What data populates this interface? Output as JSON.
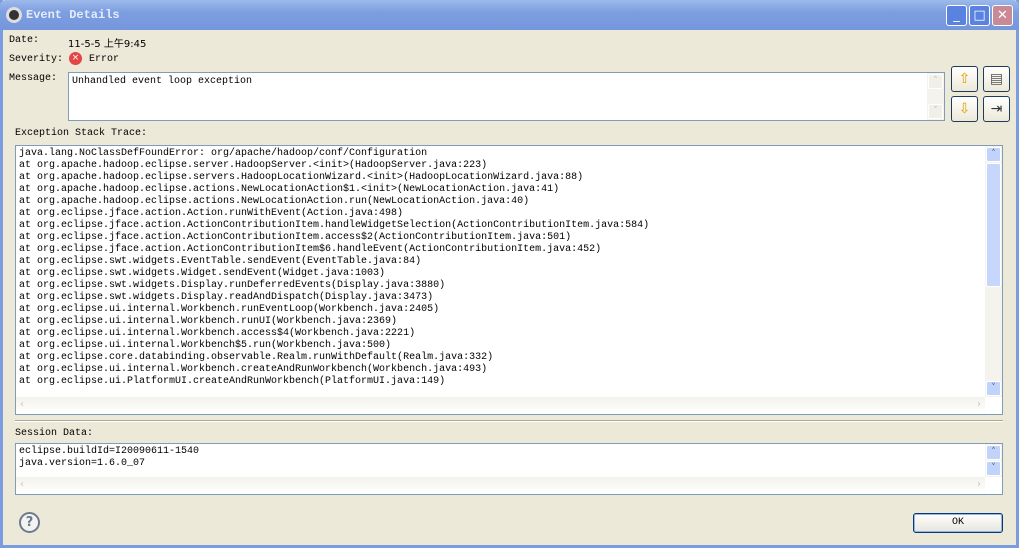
{
  "window": {
    "title": "Event Details",
    "minimize": "_",
    "maximize": "□",
    "close": "✕"
  },
  "date": {
    "label": "Date:",
    "value": "11-5-5 上午9:45"
  },
  "severity": {
    "label": "Severity:",
    "value": "Error",
    "icon": "error-icon"
  },
  "message": {
    "label": "Message:",
    "value": "Unhandled event loop exception"
  },
  "side_buttons": {
    "previous": "⇧",
    "next": "⇩",
    "copy": "▤",
    "filter": "⇥"
  },
  "stack": {
    "label": "Exception Stack Trace:",
    "lines": [
      "java.lang.NoClassDefFoundError: org/apache/hadoop/conf/Configuration",
      "at org.apache.hadoop.eclipse.server.HadoopServer.<init>(HadoopServer.java:223)",
      "at org.apache.hadoop.eclipse.servers.HadoopLocationWizard.<init>(HadoopLocationWizard.java:88)",
      "at org.apache.hadoop.eclipse.actions.NewLocationAction$1.<init>(NewLocationAction.java:41)",
      "at org.apache.hadoop.eclipse.actions.NewLocationAction.run(NewLocationAction.java:40)",
      "at org.eclipse.jface.action.Action.runWithEvent(Action.java:498)",
      "at org.eclipse.jface.action.ActionContributionItem.handleWidgetSelection(ActionContributionItem.java:584)",
      "at org.eclipse.jface.action.ActionContributionItem.access$2(ActionContributionItem.java:501)",
      "at org.eclipse.jface.action.ActionContributionItem$6.handleEvent(ActionContributionItem.java:452)",
      "at org.eclipse.swt.widgets.EventTable.sendEvent(EventTable.java:84)",
      "at org.eclipse.swt.widgets.Widget.sendEvent(Widget.java:1003)",
      "at org.eclipse.swt.widgets.Display.runDeferredEvents(Display.java:3880)",
      "at org.eclipse.swt.widgets.Display.readAndDispatch(Display.java:3473)",
      "at org.eclipse.ui.internal.Workbench.runEventLoop(Workbench.java:2405)",
      "at org.eclipse.ui.internal.Workbench.runUI(Workbench.java:2369)",
      "at org.eclipse.ui.internal.Workbench.access$4(Workbench.java:2221)",
      "at org.eclipse.ui.internal.Workbench$5.run(Workbench.java:500)",
      "at org.eclipse.core.databinding.observable.Realm.runWithDefault(Realm.java:332)",
      "at org.eclipse.ui.internal.Workbench.createAndRunWorkbench(Workbench.java:493)",
      "at org.eclipse.ui.PlatformUI.createAndRunWorkbench(PlatformUI.java:149)"
    ]
  },
  "session": {
    "label": "Session Data:",
    "lines": [
      "eclipse.buildId=I20090611-1540",
      "java.version=1.6.0_07"
    ]
  },
  "footer": {
    "help": "?",
    "ok": "OK"
  }
}
